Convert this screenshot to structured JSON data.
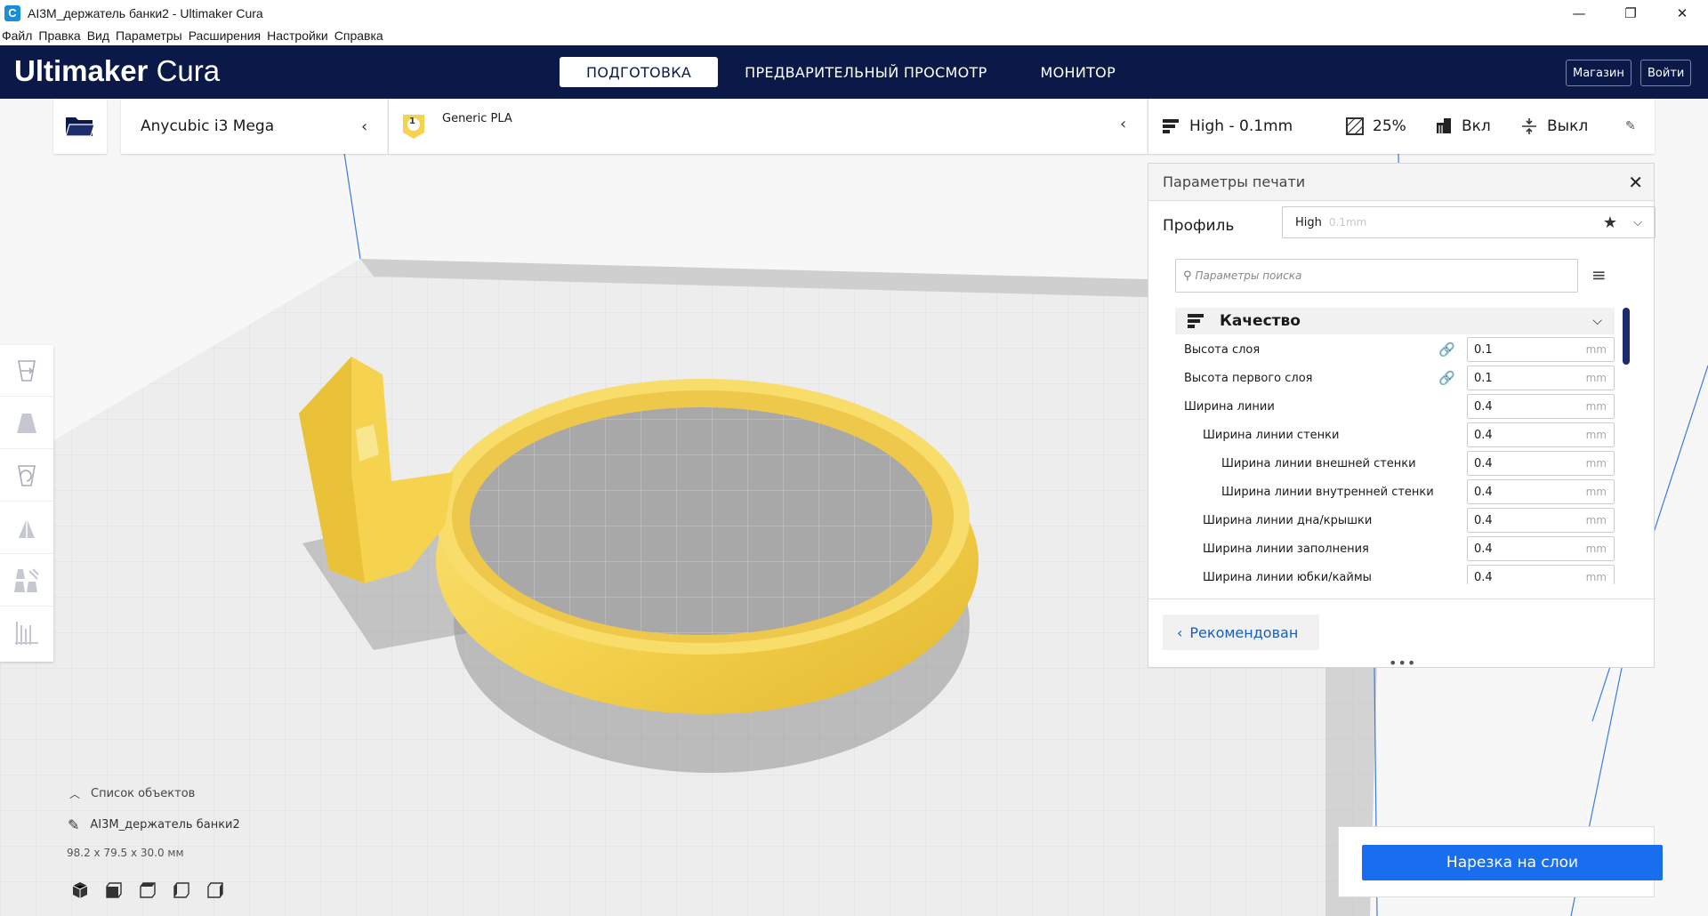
{
  "window": {
    "title": "AI3M_держатель банки2 - Ultimaker Cura",
    "app_icon": "C",
    "minimize": "—",
    "maximize": "❐",
    "close": "✕"
  },
  "menu": [
    "Файл",
    "Правка",
    "Вид",
    "Параметры",
    "Расширения",
    "Настройки",
    "Справка"
  ],
  "header": {
    "logo_bold": "Ultimaker",
    "logo_light": "Cura",
    "tabs": [
      {
        "label": "ПОДГОТОВКА",
        "active": true
      },
      {
        "label": "ПРЕДВАРИТЕЛЬНЫЙ ПРОСМОТР",
        "active": false
      },
      {
        "label": "МОНИТОР",
        "active": false
      }
    ],
    "marketplace": "Магазин",
    "signin": "Войти"
  },
  "toolbar": {
    "printer": "Anycubic i3 Mega",
    "extruder_number": "1",
    "material": "Generic PLA",
    "profile": "High - 0.1mm",
    "infill": "25%",
    "support": "Вкл",
    "adhesion": "Выкл"
  },
  "print_settings": {
    "title": "Параметры печати",
    "profile_label": "Профиль",
    "profile_value": "High",
    "profile_sub": "0.1mm",
    "search_placeholder": "Параметры поиска",
    "category": "Качество",
    "settings": [
      {
        "label": "Высота слоя",
        "value": "0.1",
        "unit": "mm",
        "indent": 0,
        "linked": true
      },
      {
        "label": "Высота первого слоя",
        "value": "0.1",
        "unit": "mm",
        "indent": 0,
        "linked": true
      },
      {
        "label": "Ширина линии",
        "value": "0.4",
        "unit": "mm",
        "indent": 0,
        "linked": false
      },
      {
        "label": "Ширина линии стенки",
        "value": "0.4",
        "unit": "mm",
        "indent": 1,
        "linked": false
      },
      {
        "label": "Ширина линии внешней стенки",
        "value": "0.4",
        "unit": "mm",
        "indent": 2,
        "linked": false
      },
      {
        "label": "Ширина линии внутренней стенки",
        "value": "0.4",
        "unit": "mm",
        "indent": 2,
        "linked": false
      },
      {
        "label": "Ширина линии дна/крышки",
        "value": "0.4",
        "unit": "mm",
        "indent": 1,
        "linked": false
      },
      {
        "label": "Ширина линии заполнения",
        "value": "0.4",
        "unit": "mm",
        "indent": 1,
        "linked": false
      },
      {
        "label": "Ширина линии юбки/каймы",
        "value": "0.4",
        "unit": "mm",
        "indent": 1,
        "linked": false
      }
    ],
    "recommended": "Рекомендован"
  },
  "object_list": {
    "toggle": "Список объектов",
    "object_name": "AI3M_держатель банки2",
    "dimensions": "98.2 x 79.5 x 30.0 мм"
  },
  "slice_button": "Нарезка на слои",
  "colors": {
    "header_bg": "#0b1949",
    "model": "#f5d34f",
    "slice": "#196ef0"
  }
}
